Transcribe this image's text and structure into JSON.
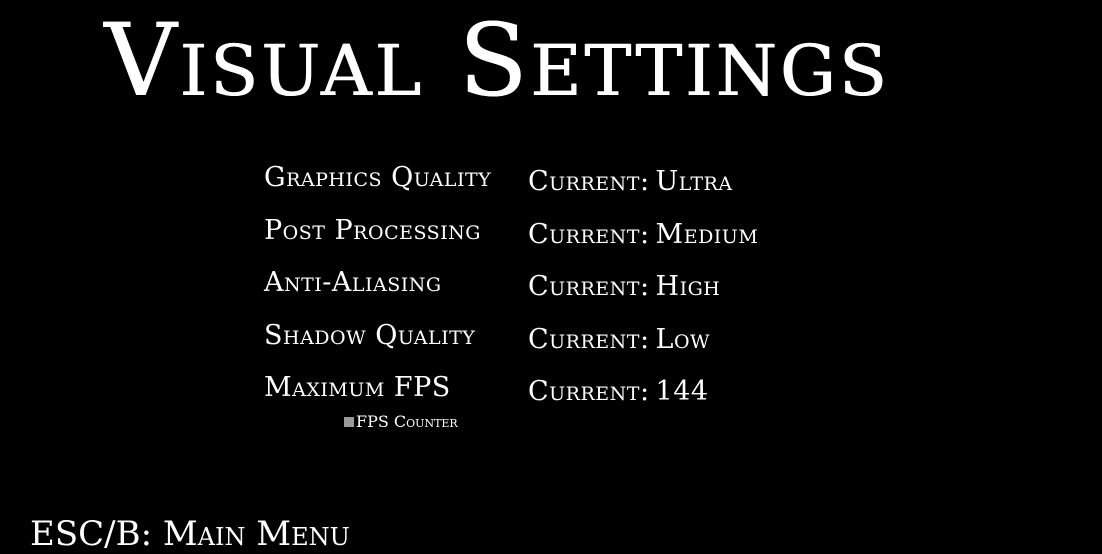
{
  "title": "Visual Settings",
  "settings": [
    {
      "label": "Graphics Quality",
      "prefix": "Current:",
      "value": "Ultra"
    },
    {
      "label": "Post Processing",
      "prefix": "Current:",
      "value": "Medium"
    },
    {
      "label": "Anti-Aliasing",
      "prefix": "Current:",
      "value": "High"
    },
    {
      "label": "Shadow Quality",
      "prefix": "Current:",
      "value": "Low"
    },
    {
      "label": "Maximum FPS",
      "prefix": "Current:",
      "value": "144"
    }
  ],
  "fps_counter": {
    "label": "FPS Counter",
    "checked": false
  },
  "back_hint": "ESC/B: Main Menu",
  "colors": {
    "background": "#000000",
    "text": "#ffffff",
    "checkbox": "#9a9a9a"
  }
}
